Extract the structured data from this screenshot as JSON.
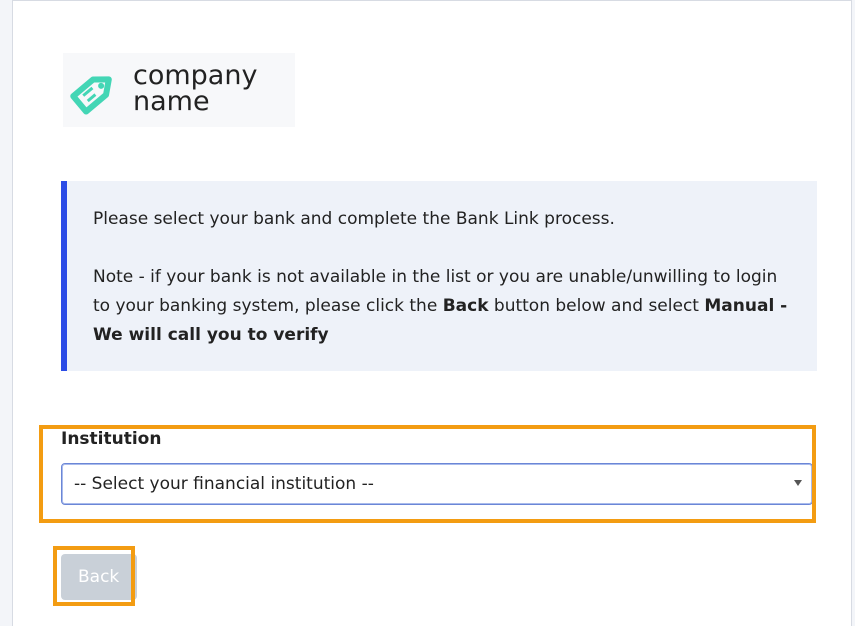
{
  "logo": {
    "line1": "company",
    "line2": "name",
    "icon": "tag-icon",
    "icon_color": "#43d6b5"
  },
  "info": {
    "line1": "Please select your bank and complete the Bank Link process.",
    "note_part1": "Note - if your bank is not available in the list or you are unable/unwilling to login to your banking system, please click the ",
    "note_bold1": "Back",
    "note_part2": " button below and select ",
    "note_bold2": "Manual - We will call you to verify",
    "accent_color": "#2b4ce6"
  },
  "institution": {
    "label": "Institution",
    "selected": "-- Select your financial institution --"
  },
  "buttons": {
    "back": "Back"
  },
  "highlight_color": "#f39c12"
}
